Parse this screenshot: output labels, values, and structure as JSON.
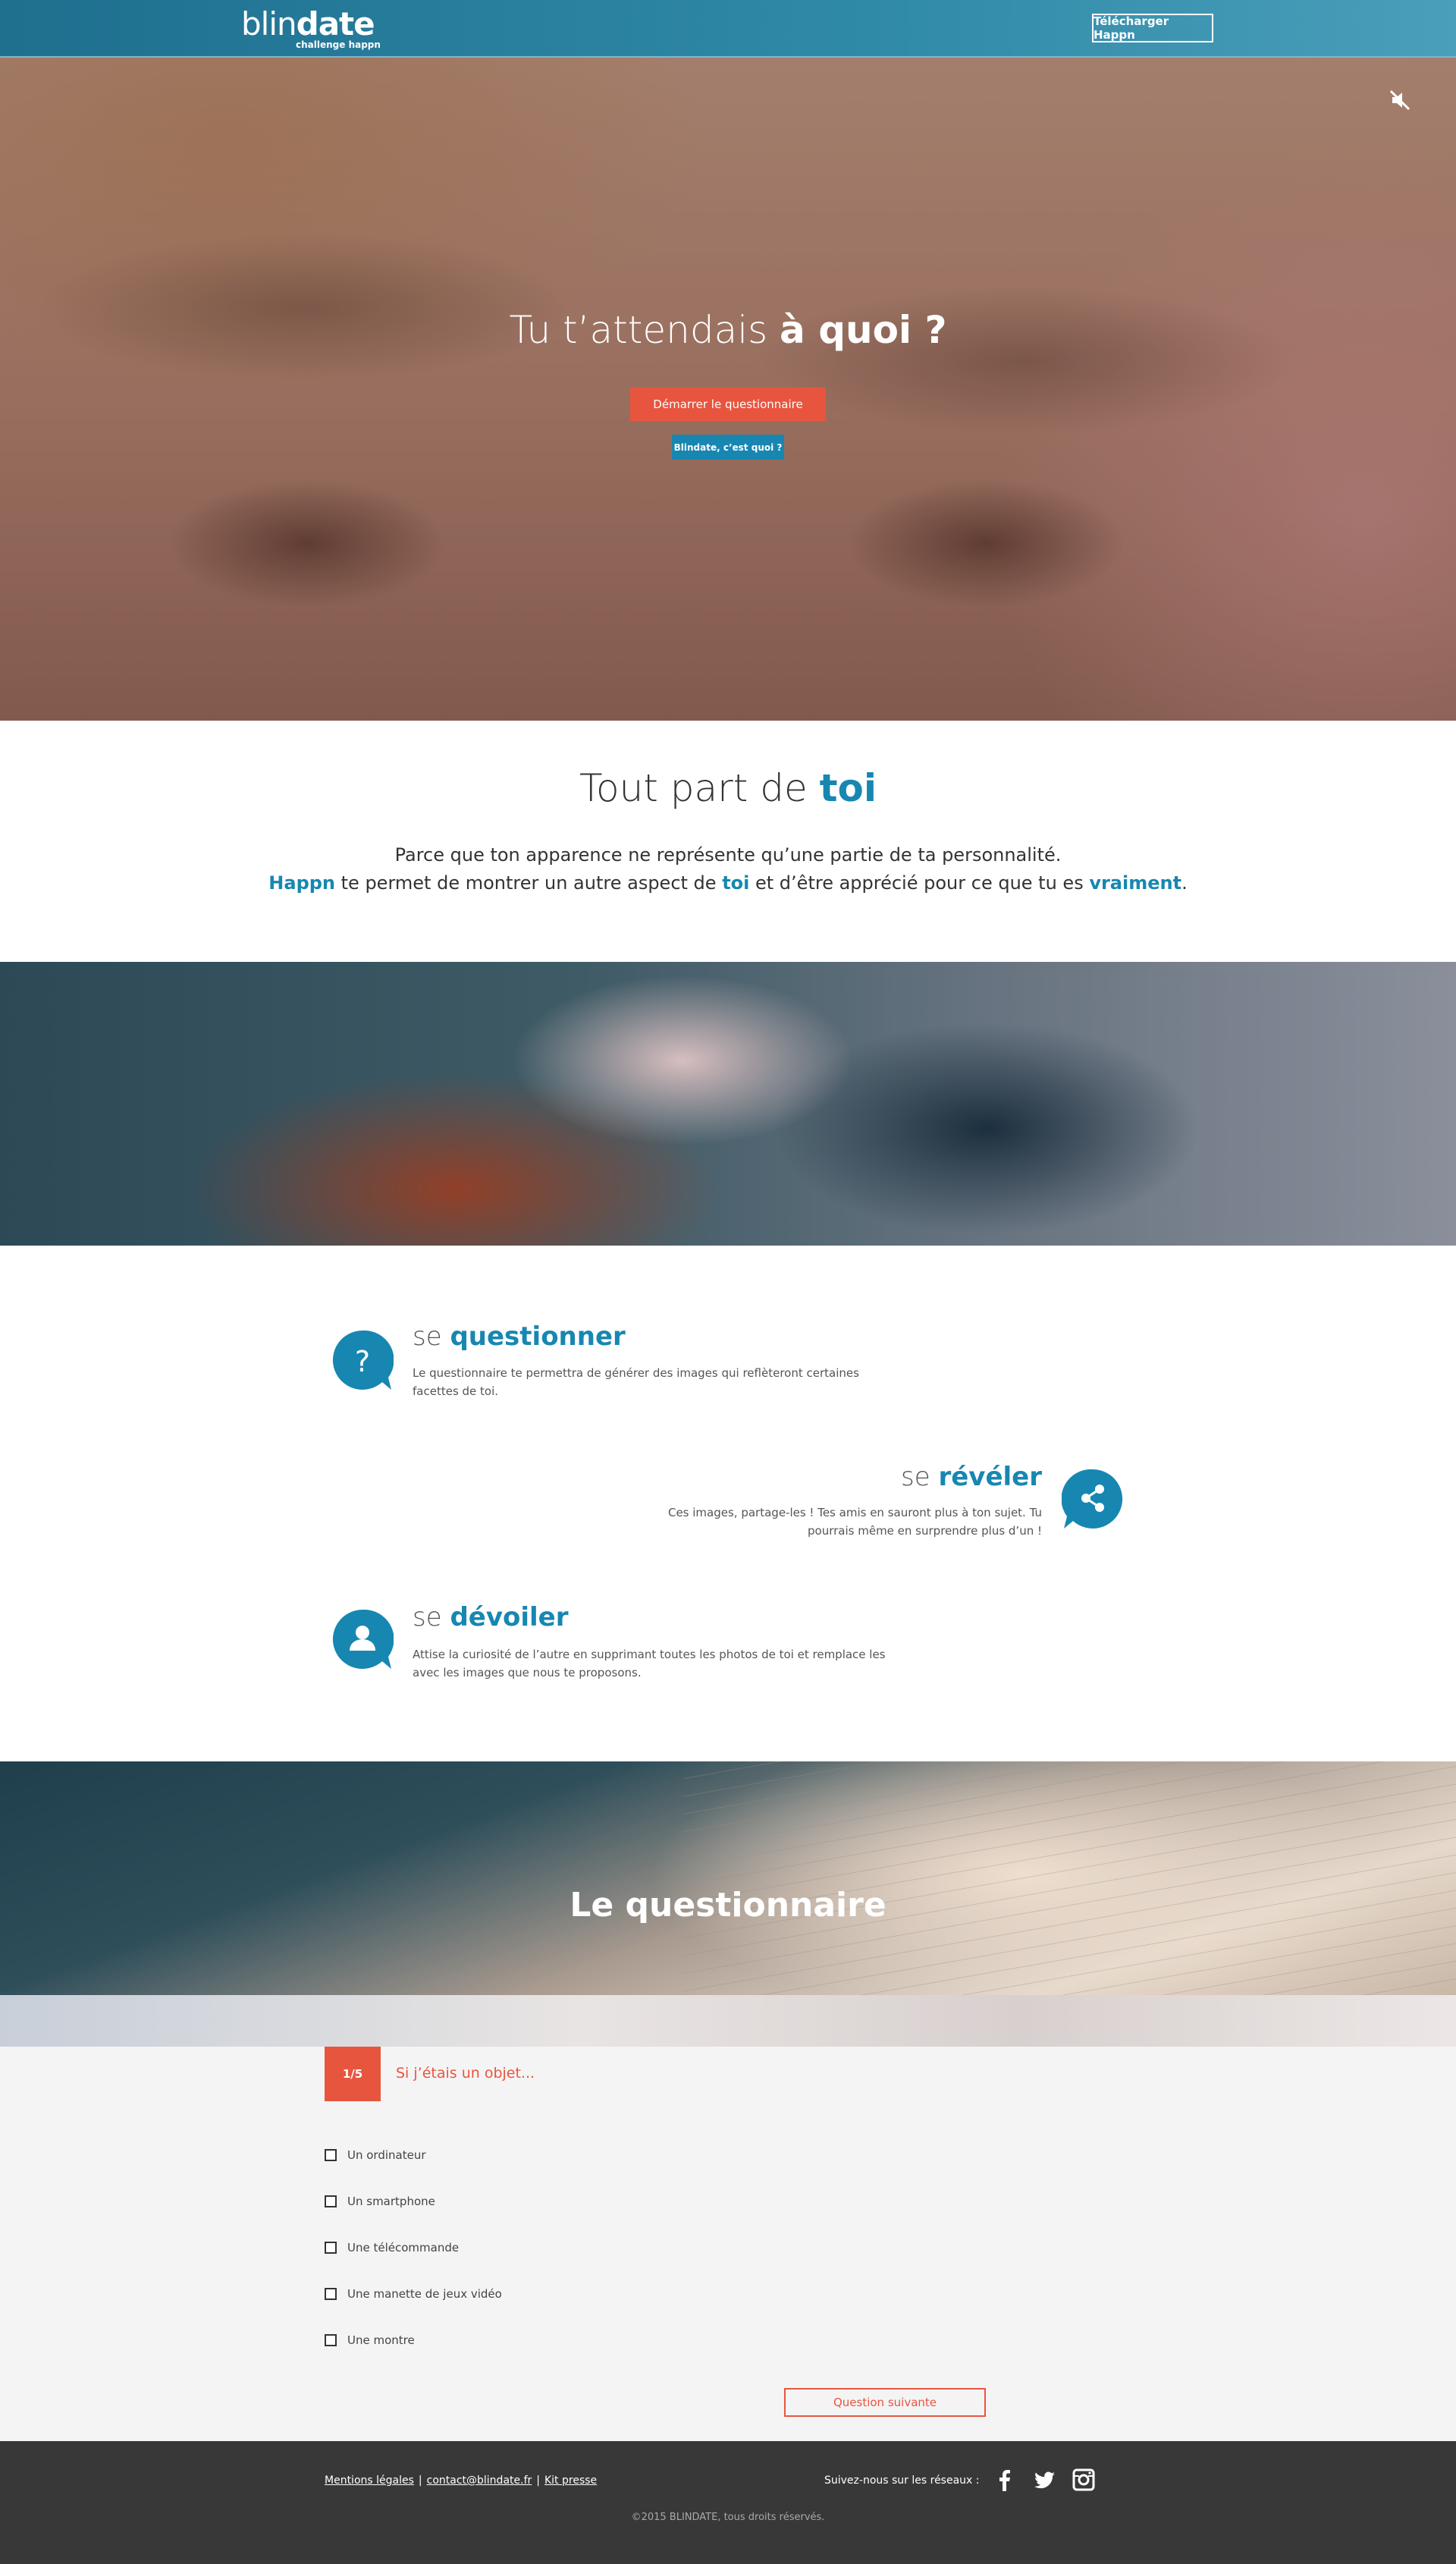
{
  "header": {
    "logo_part1": "blin",
    "logo_part2": "date",
    "logo_sub": "challenge happn",
    "download_label": "Télécharger Happn"
  },
  "hero": {
    "title_light": "Tu t’attendais ",
    "title_bold": "à quoi ?",
    "start_label": "Démarrer le questionnaire",
    "what_label": "Blindate, c’est quoi ?",
    "mute_icon": "speaker-muted-icon"
  },
  "intro": {
    "title_light": "Tout part de ",
    "title_highlight": "toi",
    "line1": "Parce que ton apparence ne représente qu’une partie de ta personnalité.",
    "line2_parts": {
      "happn": "Happn",
      "a": " te permet de montrer un autre aspect de ",
      "toi": "toi",
      "b": " et d’être apprécié pour ce que tu es ",
      "vraiment": "vraiment",
      "c": "."
    }
  },
  "features": [
    {
      "prefix": "se ",
      "highlight": "questionner",
      "desc": "Le questionnaire te permettra de générer des images qui reflèteront certaines facettes de toi.",
      "icon": "question-mark-icon"
    },
    {
      "prefix": "se ",
      "highlight": "révéler",
      "desc": "Ces images, partage-les ! Tes amis en sauront plus à ton sujet. Tu pourrais même en surprendre plus d’un !",
      "icon": "share-icon"
    },
    {
      "prefix": "se ",
      "highlight": "dévoiler",
      "desc": "Attise la curiosité de l’autre en supprimant toutes les photos de toi et remplace les avec les images que nous te proposons.",
      "icon": "user-icon"
    }
  ],
  "questionnaire": {
    "banner_title": "Le questionnaire",
    "step": "1/5",
    "question": "Si j’étais un objet...",
    "options": [
      "Un ordinateur",
      "Un smartphone",
      "Une télécommande",
      "Une manette de jeux vidéo",
      "Une montre"
    ],
    "next_label": "Question suivante"
  },
  "footer": {
    "links": [
      "Mentions légales",
      "contact@blindate.fr",
      "Kit presse"
    ],
    "separator": "|",
    "follow_label": "Suivez-nous sur les réseaux :",
    "social_icons": [
      "facebook-icon",
      "twitter-icon",
      "instagram-icon"
    ],
    "copyright": "©2015 BLINDATE, tous droits réservés."
  },
  "colors": {
    "accent_blue": "#1787b1",
    "accent_red": "#e8553f",
    "footer_bg": "#383838",
    "question_bg": "#f4f4f4"
  }
}
